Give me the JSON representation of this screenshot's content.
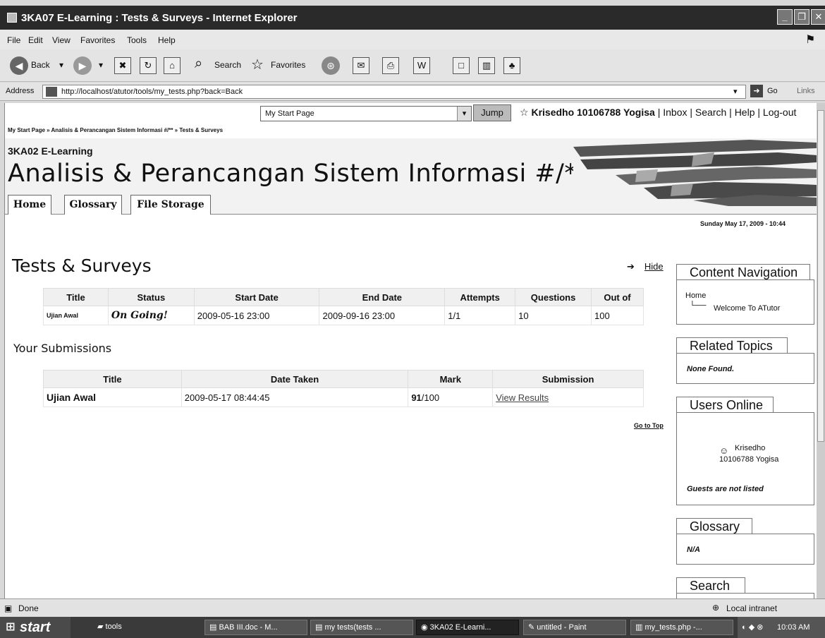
{
  "window": {
    "title": "3KA07 E-Learning : Tests & Surveys - Internet Explorer"
  },
  "menu": [
    "File",
    "Edit",
    "View",
    "Favorites",
    "Tools",
    "Help"
  ],
  "toolbar": {
    "back": "Back",
    "search": "Search",
    "favorites": "Favorites"
  },
  "address": {
    "label": "Address",
    "url": "http://localhost/atutor/tools/my_tests.php?back=Back",
    "go": "Go",
    "links": "Links"
  },
  "page": {
    "jump_select": "My Start Page",
    "jump_button": "Jump",
    "user": "Krisedho 10106788 Yogisa",
    "user_links": [
      "Inbox",
      "Search",
      "Help",
      "Log-out"
    ],
    "breadcrumb": "My Start Page » Analisis & Perancangan Sistem Informasi #/** » Tests & Surveys",
    "site_name": "3KA02 E-Learning",
    "course_title": "Analisis & Perancangan Sistem Informasi #/**",
    "tabs": [
      "Home",
      "Glossary",
      "File Storage"
    ],
    "datetime": "Sunday May 17, 2009 - 10:44",
    "title": "Tests & Surveys",
    "hide": "Hide",
    "tests_table": {
      "headers": [
        "Title",
        "Status",
        "Start Date",
        "End Date",
        "Attempts",
        "Questions",
        "Out of"
      ],
      "rows": [
        [
          "Ujian Awal",
          "On Going!",
          "2009-05-16 23:00",
          "2009-09-16 23:00",
          "1/1",
          "10",
          "100"
        ]
      ]
    },
    "submissions_heading": "Your Submissions",
    "submissions_table": {
      "headers": [
        "Title",
        "Date Taken",
        "Mark",
        "Submission"
      ],
      "rows": [
        {
          "title": "Ujian Awal",
          "date": "2009-05-17 08:44:45",
          "mark_bold": "91",
          "mark_rest": "/100",
          "link": "View Results"
        }
      ]
    },
    "go_to_top": "Go to Top"
  },
  "sidebar": {
    "content_nav": {
      "title": "Content Navigation",
      "home": "Home",
      "item": "Welcome To ATutor"
    },
    "related": {
      "title": "Related Topics",
      "text": "None Found."
    },
    "users_online": {
      "title": "Users Online",
      "user_line1": "Krisedho",
      "user_line2": "10106788 Yogisa",
      "guests": "Guests are not listed"
    },
    "glossary": {
      "title": "Glossary",
      "text": "N/A"
    },
    "search": {
      "title": "Search"
    }
  },
  "status": {
    "left": "Done",
    "zone": "Local intranet"
  },
  "taskbar": {
    "start": "start",
    "items": [
      "tools",
      "BAB III.doc - M...",
      "my tests(tests ...",
      "3KA02 E-Learni...",
      "untitled - Paint",
      "my_tests.php -..."
    ],
    "clock": "10:03 AM"
  }
}
